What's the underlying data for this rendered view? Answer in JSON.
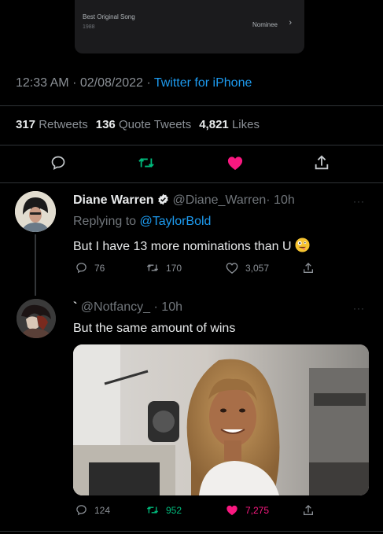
{
  "card": {
    "title": "Best Original Song",
    "year": "1988",
    "status": "Nominee"
  },
  "tweet": {
    "time": "12:33 AM",
    "separator": "·",
    "date": "02/08/2022",
    "source": "Twitter for iPhone",
    "retweets_count": "317",
    "retweets_label": "Retweets",
    "quotes_count": "136",
    "quotes_label": "Quote Tweets",
    "likes_count": "4,821",
    "likes_label": "Likes",
    "liked": true
  },
  "reply1": {
    "name": "Diane Warren",
    "verified": true,
    "handle": "@Diane_Warren",
    "time": "· 10h",
    "replying_prefix": "Replying to",
    "replying_to": "@TaylorBold",
    "text": "But I have 13 more nominations than U",
    "emoji": "zany-face-emoji",
    "replies": "76",
    "retweets": "170",
    "likes": "3,057"
  },
  "reply2": {
    "name": "`",
    "handle": "@Notfancy_",
    "time": "· 10h",
    "text": "But the same amount of wins",
    "media": "gif-woman-smiling",
    "replies": "124",
    "retweets": "952",
    "likes": "7,275",
    "retweeted": true,
    "liked": true
  },
  "colors": {
    "accent": "#1d9bf0",
    "retweet": "#00ba7c",
    "like": "#f91880",
    "background": "#000000"
  }
}
